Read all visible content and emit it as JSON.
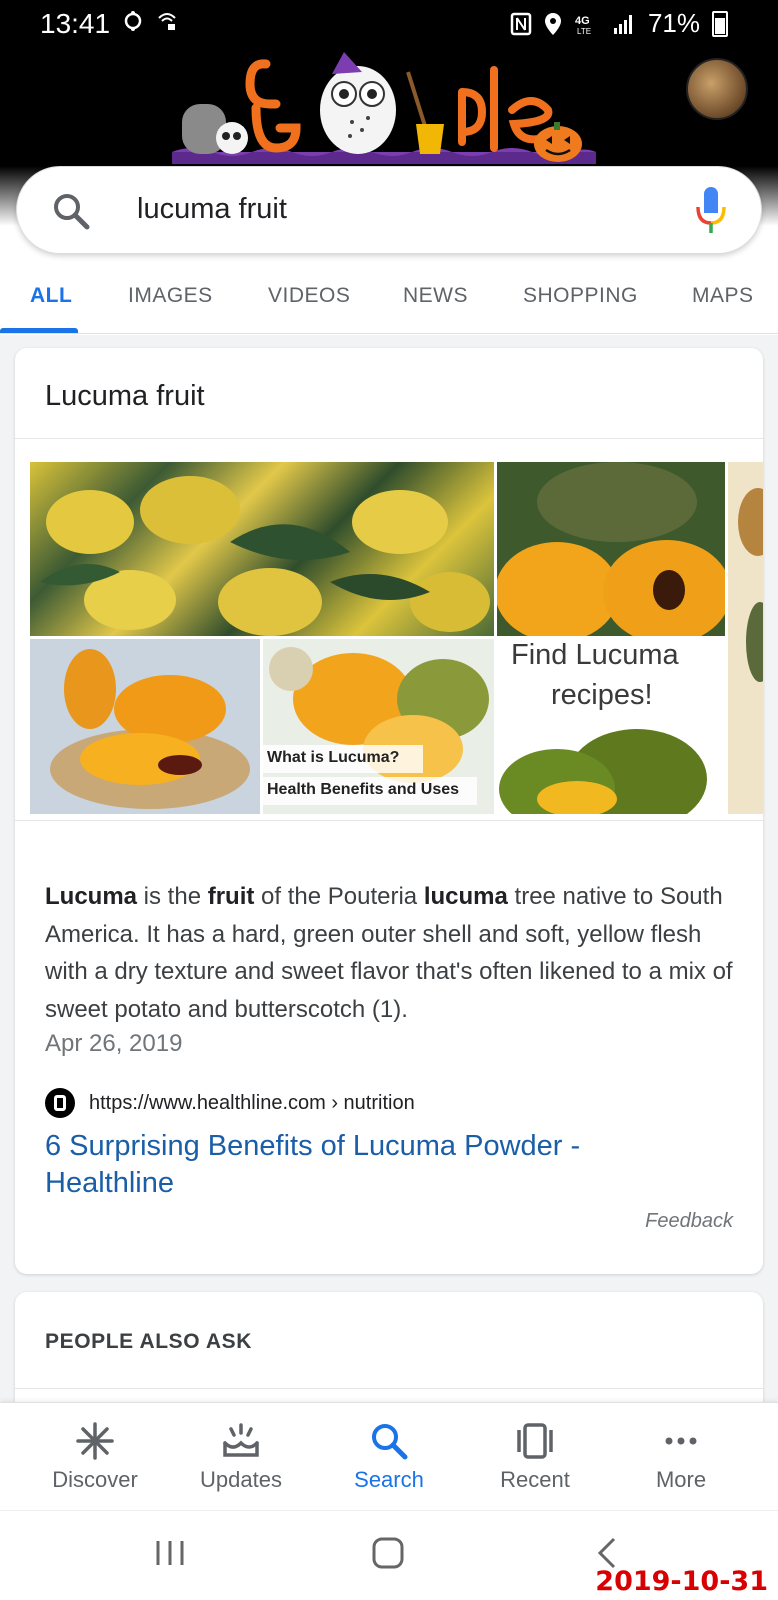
{
  "status_bar": {
    "time": "13:41",
    "battery": "71%"
  },
  "search": {
    "query": "lucuma fruit"
  },
  "tabs": [
    {
      "label": "ALL"
    },
    {
      "label": "IMAGES"
    },
    {
      "label": "VIDEOS"
    },
    {
      "label": "NEWS"
    },
    {
      "label": "SHOPPING"
    },
    {
      "label": "MAPS"
    }
  ],
  "knowledge_card": {
    "title": "Lucuma fruit",
    "images": [
      {
        "overlay_1": "What is Lucuma?",
        "overlay_2": "Health Benefits and Uses"
      },
      {
        "overlay_1": "Find Lucuma",
        "overlay_2": "recipes!"
      }
    ],
    "description": {
      "t1": "Lucuma",
      "t2": " is the ",
      "t3": "fruit",
      "t4": " of the Pouteria ",
      "t5": "lucuma",
      "t6": " tree native to South America. It has a hard, green outer shell and soft, yellow flesh with a dry texture and sweet flavor that's often likened to a mix of sweet potato and butterscotch (1)."
    },
    "date": "Apr 26, 2019",
    "source_url": "https://www.healthline.com › nutrition",
    "link_title": "6 Surprising Benefits of Lucuma Powder - Healthline",
    "feedback": "Feedback"
  },
  "people_also_ask": {
    "title": "PEOPLE ALSO ASK"
  },
  "bottom_nav": [
    {
      "label": "Discover",
      "icon": "asterisk-icon"
    },
    {
      "label": "Updates",
      "icon": "updates-icon"
    },
    {
      "label": "Search",
      "icon": "search-icon"
    },
    {
      "label": "Recent",
      "icon": "recent-icon"
    },
    {
      "label": "More",
      "icon": "more-icon"
    }
  ],
  "stamp": "2019-10-31",
  "colors": {
    "accent": "#1a73e8",
    "link": "#1a5ea8",
    "stamp": "#d80000"
  }
}
